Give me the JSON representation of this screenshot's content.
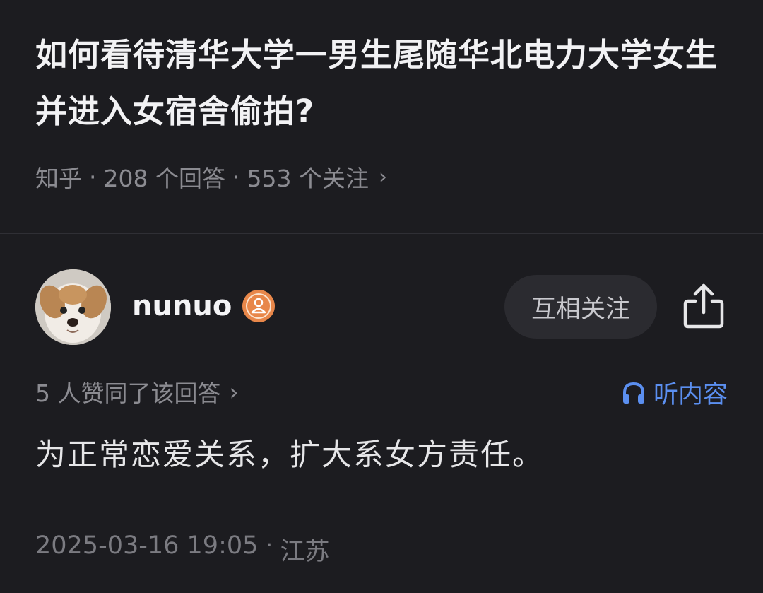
{
  "question": {
    "title": "如何看待清华大学一男生尾随华北电力大学女生并进入女宿舍偷拍?",
    "source": "知乎",
    "answers_count": "208 个回答",
    "followers_count": "553 个关注",
    "separator": "·",
    "chevron": "›"
  },
  "answer": {
    "author": {
      "name": "nunuo",
      "badge_icon": "user-badge-icon",
      "avatar_icon": "puppy-avatar"
    },
    "follow_label": "互相关注",
    "share_icon": "share-icon",
    "upvote_text": "5 人赞同了该回答",
    "upvote_chevron": "›",
    "listen_label": "听内容",
    "listen_icon": "headphones-icon",
    "content": "为正常恋爱关系，扩大系女方责任。",
    "date": "2025-03-16 19:05",
    "date_separator": "·",
    "location": "江苏"
  },
  "colors": {
    "background": "#1c1c20",
    "accent_blue": "#5b8ff0",
    "badge_orange": "#e8874a"
  }
}
